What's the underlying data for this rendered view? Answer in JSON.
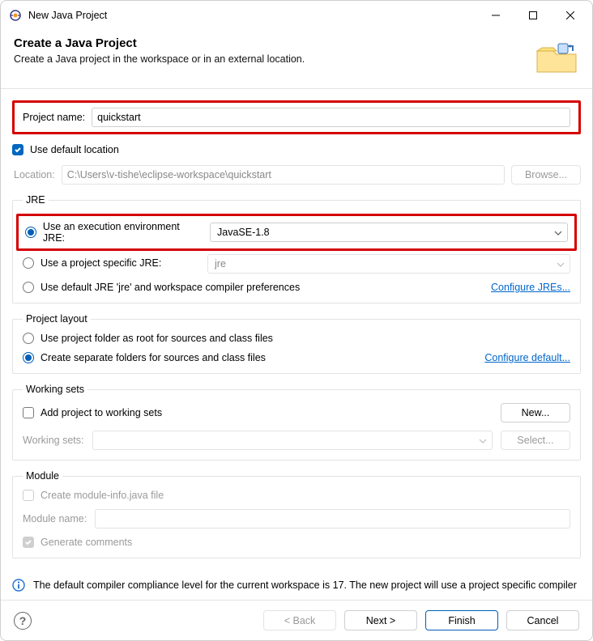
{
  "window": {
    "title": "New Java Project"
  },
  "banner": {
    "heading": "Create a Java Project",
    "description": "Create a Java project in the workspace or in an external location."
  },
  "project": {
    "name_label": "Project name:",
    "name_value": "quickstart",
    "use_default_location_label": "Use default location",
    "location_label": "Location:",
    "location_value": "C:\\Users\\v-tishe\\eclipse-workspace\\quickstart",
    "browse_label": "Browse..."
  },
  "jre": {
    "legend": "JRE",
    "exec_env_label": "Use an execution environment JRE:",
    "exec_env_value": "JavaSE-1.8",
    "project_specific_label": "Use a project specific JRE:",
    "project_specific_value": "jre",
    "default_jre_label": "Use default JRE 'jre' and workspace compiler preferences",
    "configure_link": "Configure JREs..."
  },
  "layout": {
    "legend": "Project layout",
    "root_label": "Use project folder as root for sources and class files",
    "separate_label": "Create separate folders for sources and class files",
    "configure_link": "Configure default..."
  },
  "working_sets": {
    "legend": "Working sets",
    "add_label": "Add project to working sets",
    "new_label": "New...",
    "ws_label": "Working sets:",
    "select_label": "Select..."
  },
  "module": {
    "legend": "Module",
    "create_module_info_label": "Create module-info.java file",
    "module_name_label": "Module name:",
    "generate_comments_label": "Generate comments"
  },
  "info": {
    "message": "The default compiler compliance level for the current workspace is 17. The new project will use a project specific compiler"
  },
  "footer": {
    "back": "< Back",
    "next": "Next >",
    "finish": "Finish",
    "cancel": "Cancel"
  }
}
